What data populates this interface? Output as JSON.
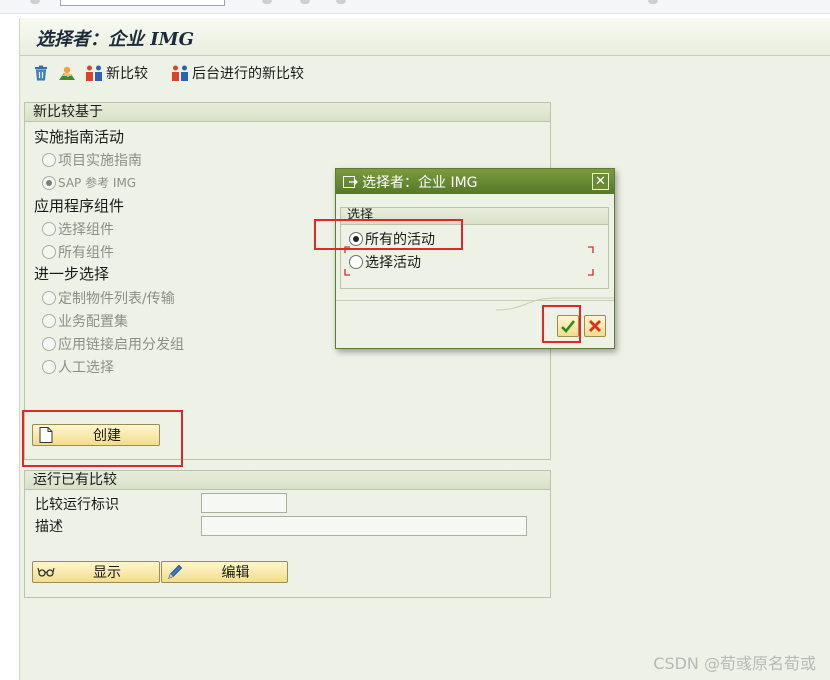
{
  "screen_title": "选择者：企业 IMG",
  "toolbar": {
    "new_compare_label": "新比较",
    "background_compare_label": "后台进行的新比较"
  },
  "new_compare_group": {
    "title": "新比较基于",
    "section_impl": "实施指南活动",
    "radio_project_guide": "项目实施指南",
    "radio_sap_ref": "SAP 参考 IMG",
    "section_app": "应用程序组件",
    "radio_select_components": "选择组件",
    "radio_all_components": "所有组件",
    "section_further": "进一步选择",
    "radio_custom_objects": "定制物件列表/传输",
    "radio_business_config": "业务配置集",
    "radio_app_link": "应用链接启用分发组",
    "radio_manual": "人工选择",
    "create_button": "创建"
  },
  "existing_compare_group": {
    "title": "运行已有比较",
    "run_id_label": "比较运行标识",
    "run_id_value": "",
    "description_label": "描述",
    "description_value": "",
    "display_button": "显示",
    "edit_button": "编辑"
  },
  "dialog": {
    "title": "选择者：企业 IMG",
    "group_title": "选择",
    "option_all": "所有的活动",
    "option_selected": "选择活动"
  },
  "watermark": "CSDN @荀彧原名荀或",
  "colors": {
    "highlight_red": "#e0282b",
    "dialog_title_green": "#55782a",
    "button_yellow": "#f2dd8c"
  }
}
